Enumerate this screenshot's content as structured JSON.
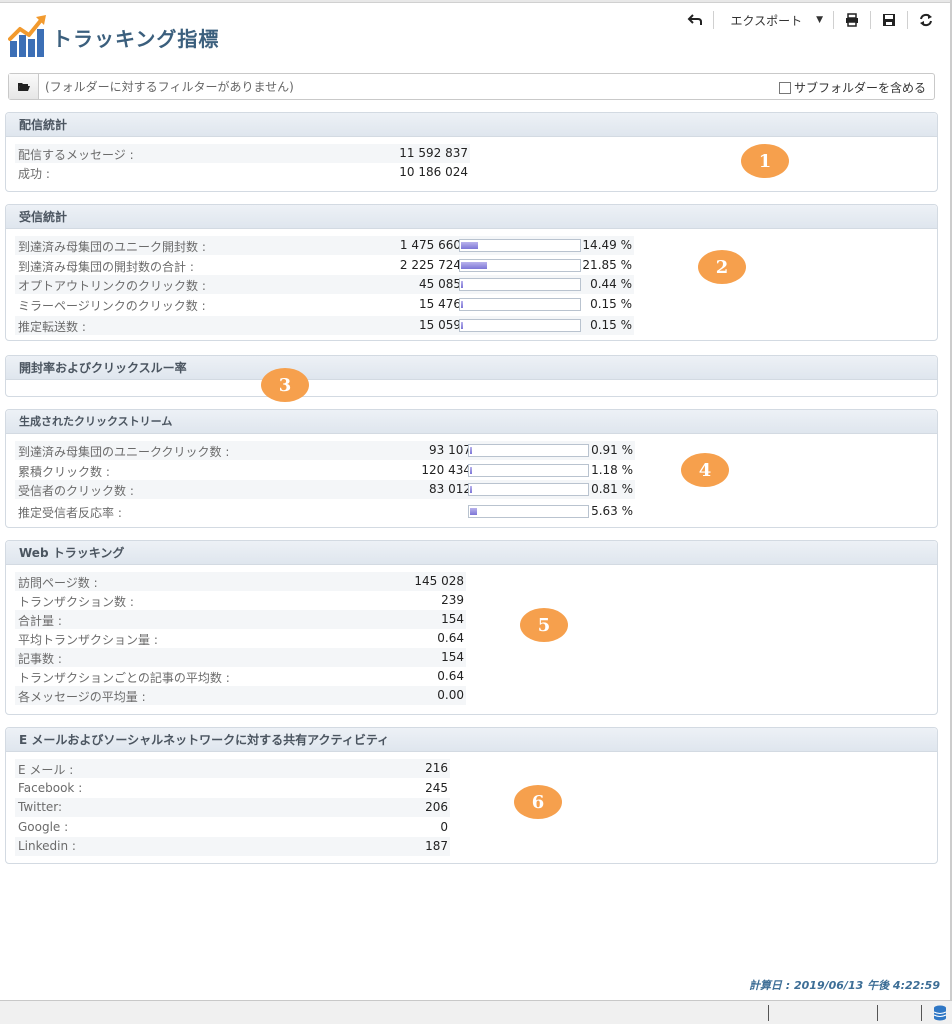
{
  "header": {
    "title": "トラッキング指標"
  },
  "toolbar": {
    "back_icon": "back-arrow-icon",
    "export_label": "エクスポート",
    "print_icon": "print-icon",
    "save_icon": "save-icon",
    "refresh_icon": "refresh-icon"
  },
  "filter": {
    "folder_icon": "folder-icon",
    "text": "(フォルダーに対するフィルターがありません)",
    "subfolder_label": "サブフォルダーを含める",
    "subfolder_checked": false
  },
  "sections": {
    "delivery": {
      "title": "配信統計",
      "marker": "1",
      "rows": [
        {
          "label": "配信するメッセージ :",
          "value": "11 592 837"
        },
        {
          "label": "成功 :",
          "value": "10 186 024"
        }
      ]
    },
    "reception": {
      "title": "受信統計",
      "marker": "2",
      "rows": [
        {
          "label": "到達済み母集団のユニーク開封数 :",
          "value": "1 475 660",
          "percent": "14.49 %",
          "ratio": 0.1449
        },
        {
          "label": "到達済み母集団の開封数の合計 :",
          "value": "2 225 724",
          "percent": "21.85 %",
          "ratio": 0.2185
        },
        {
          "label": "オプトアウトリンクのクリック数 :",
          "value": "45 085",
          "percent": "0.44 %",
          "ratio": 0.0044
        },
        {
          "label": "ミラーページリンクのクリック数 :",
          "value": "15 476",
          "percent": "0.15 %",
          "ratio": 0.0015
        },
        {
          "label": "推定転送数 :",
          "value": "15 059",
          "percent": "0.15 %",
          "ratio": 0.0015
        }
      ]
    },
    "rates": {
      "title": "開封率およびクリックスルー率",
      "marker": "3"
    },
    "clickstream": {
      "title": "生成されたクリックストリーム",
      "marker": "4",
      "rows": [
        {
          "label": "到達済み母集団のユニーククリック数 :",
          "value": "93 107",
          "percent": "0.91 %",
          "ratio": 0.0091
        },
        {
          "label": "累積クリック数 :",
          "value": "120 434",
          "percent": "1.18 %",
          "ratio": 0.0118
        },
        {
          "label": "受信者のクリック数 :",
          "value": "83 012",
          "percent": "0.81 %",
          "ratio": 0.0081
        },
        {
          "label": "推定受信者反応率 :",
          "value": "",
          "percent": "5.63 %",
          "ratio": 0.0563
        }
      ]
    },
    "web": {
      "title": "Web トラッキング",
      "marker": "5",
      "rows": [
        {
          "label": "訪問ページ数 :",
          "value": "145 028"
        },
        {
          "label": "トランザクション数 :",
          "value": "239"
        },
        {
          "label": "合計量 :",
          "value": "154"
        },
        {
          "label": "平均トランザクション量 :",
          "value": "0.64"
        },
        {
          "label": "記事数 :",
          "value": "154"
        },
        {
          "label": "トランザクションごとの記事の平均数 :",
          "value": "0.64"
        },
        {
          "label": "各メッセージの平均量 :",
          "value": "0.00"
        }
      ]
    },
    "social": {
      "title": "E メールおよびソーシャルネットワークに対する共有アクティビティ",
      "marker": "6",
      "rows": [
        {
          "label": "E メール :",
          "value": "216"
        },
        {
          "label": "Facebook :",
          "value": "245"
        },
        {
          "label": "Twitter:",
          "value": "206"
        },
        {
          "label": "Google :",
          "value": "0"
        },
        {
          "label": "Linkedin :",
          "value": "187"
        }
      ]
    }
  },
  "footer": {
    "computed": "計算日 : 2019/06/13 午後 4:22:59"
  },
  "colors": {
    "title": "#3b5f7d",
    "marker": "#f6a04d",
    "bar_fill": "#7d76d6",
    "footer_text": "#3d6e96"
  }
}
